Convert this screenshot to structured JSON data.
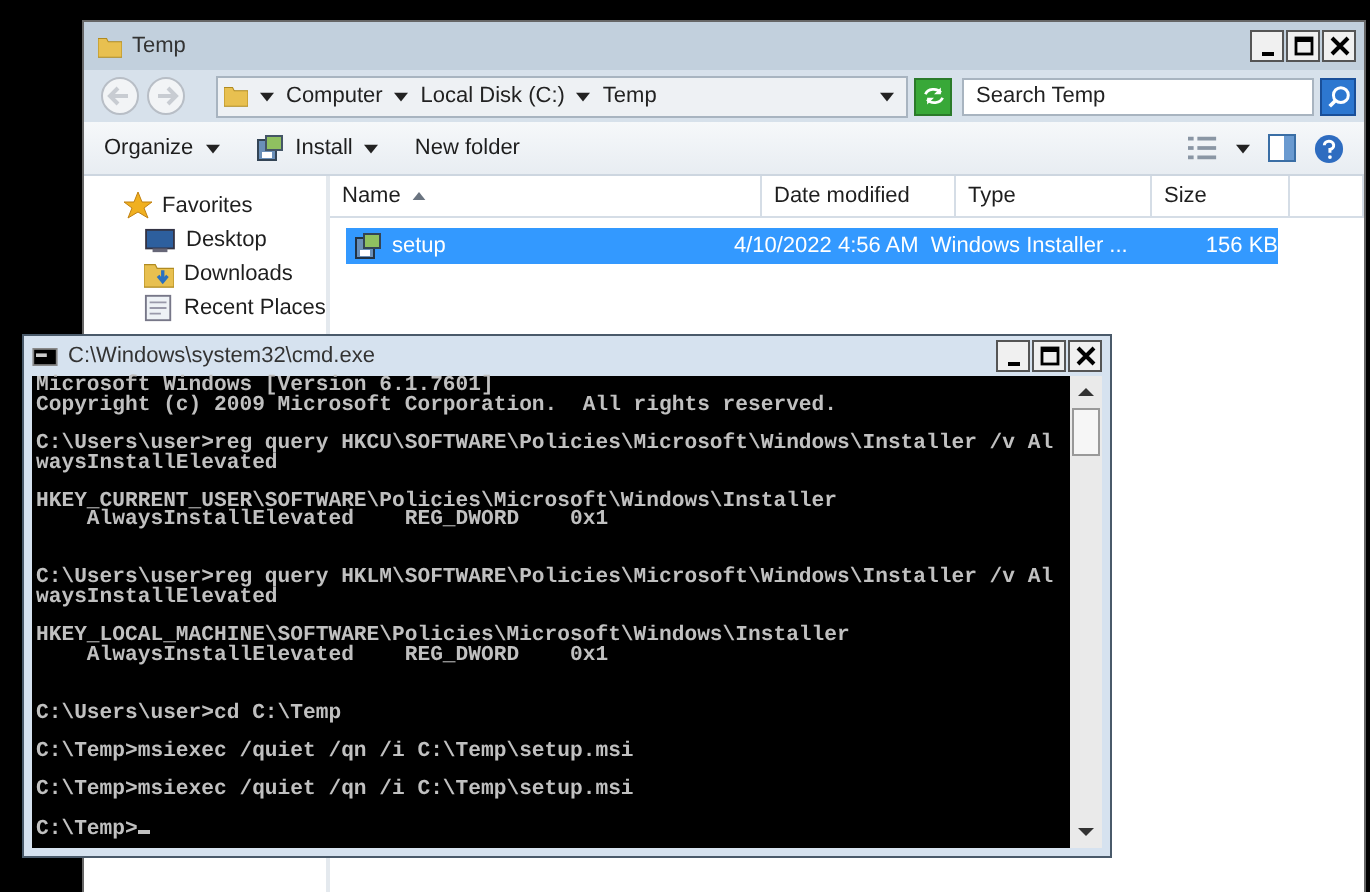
{
  "explorer": {
    "title": "Temp",
    "breadcrumb": [
      "Computer",
      "Local Disk (C:)",
      "Temp"
    ],
    "search": {
      "placeholder": "Search Temp"
    },
    "toolbar": [
      {
        "label": "Organize",
        "kind": "menu"
      },
      {
        "label": "Install",
        "kind": "install"
      },
      {
        "label": "New folder",
        "kind": "plain"
      }
    ],
    "sidebar": [
      {
        "label": "Favorites",
        "kind": "star"
      },
      {
        "label": "Desktop",
        "kind": "desktop"
      },
      {
        "label": "Downloads",
        "kind": "downloads"
      },
      {
        "label": "Recent Places",
        "kind": "recent"
      }
    ],
    "columns": [
      {
        "label": "Name",
        "sorted": true
      },
      {
        "label": "Date modified",
        "sorted": false
      },
      {
        "label": "Type",
        "sorted": false
      },
      {
        "label": "Size",
        "sorted": false
      }
    ],
    "rows": [
      {
        "name": "setup",
        "date": "4/10/2022 4:56 AM",
        "type": "Windows Installer ...",
        "size": "156 KB",
        "selected": true
      }
    ]
  },
  "console": {
    "title": "C:\\Windows\\system32\\cmd.exe",
    "lines": [
      {
        "kind": "text",
        "text": "Microsoft Windows [Version 6.1.7601]"
      },
      {
        "kind": "text",
        "text": "Copyright (c) 2009 Microsoft Corporation.  All rights reserved."
      },
      {
        "kind": "blank"
      },
      {
        "kind": "text",
        "text": "C:\\Users\\user>reg query HKCU\\SOFTWARE\\Policies\\Microsoft\\Windows\\Installer /v Al"
      },
      {
        "kind": "text",
        "text": "waysInstallElevated"
      },
      {
        "kind": "blank"
      },
      {
        "kind": "text",
        "text": "HKEY_CURRENT_USER\\SOFTWARE\\Policies\\Microsoft\\Windows\\Installer"
      },
      {
        "kind": "text",
        "text": "    AlwaysInstallElevated    REG_DWORD    0x1"
      },
      {
        "kind": "blank"
      },
      {
        "kind": "blank"
      },
      {
        "kind": "text",
        "text": "C:\\Users\\user>reg query HKLM\\SOFTWARE\\Policies\\Microsoft\\Windows\\Installer /v Al"
      },
      {
        "kind": "text",
        "text": "waysInstallElevated"
      },
      {
        "kind": "blank"
      },
      {
        "kind": "text",
        "text": "HKEY_LOCAL_MACHINE\\SOFTWARE\\Policies\\Microsoft\\Windows\\Installer"
      },
      {
        "kind": "text",
        "text": "    AlwaysInstallElevated    REG_DWORD    0x1"
      },
      {
        "kind": "blank"
      },
      {
        "kind": "blank"
      },
      {
        "kind": "text",
        "text": "C:\\Users\\user>cd C:\\Temp"
      },
      {
        "kind": "blank"
      },
      {
        "kind": "text",
        "text": "C:\\Temp>msiexec /quiet /qn /i C:\\Temp\\setup.msi"
      },
      {
        "kind": "blank"
      },
      {
        "kind": "text",
        "text": "C:\\Temp>msiexec /quiet /qn /i C:\\Temp\\setup.msi"
      },
      {
        "kind": "blank"
      },
      {
        "kind": "prompt",
        "text": "C:\\Temp>"
      }
    ]
  }
}
